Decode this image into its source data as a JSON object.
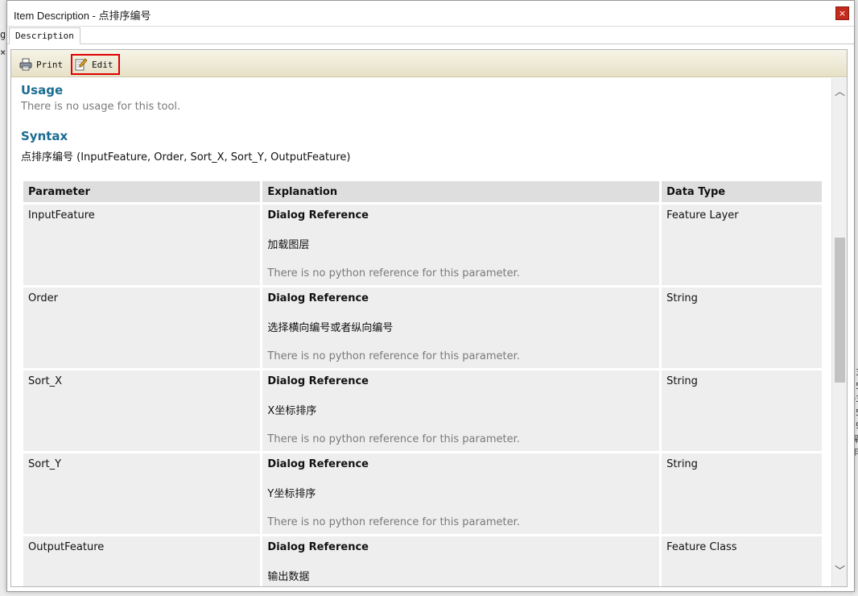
{
  "window": {
    "title": "Item Description - 点排序编号",
    "close_label": "×"
  },
  "tabs": [
    {
      "label": "Description"
    }
  ],
  "toolbar": {
    "print_label": "Print",
    "edit_label": "Edit"
  },
  "usage": {
    "heading": "Usage",
    "text": "There is no usage for this tool."
  },
  "syntax": {
    "heading": "Syntax",
    "line": "点排序编号 (InputFeature, Order, Sort_X, Sort_Y, OutputFeature)"
  },
  "table": {
    "headers": [
      "Parameter",
      "Explanation",
      "Data Type"
    ],
    "rows": [
      {
        "parameter": "InputFeature",
        "dialog_ref": "Dialog Reference",
        "description": "加载图层",
        "python_ref": "There is no python reference for this parameter.",
        "data_type": "Feature Layer"
      },
      {
        "parameter": "Order",
        "dialog_ref": "Dialog Reference",
        "description": "选择横向编号或者纵向编号",
        "python_ref": "There is no python reference for this parameter.",
        "data_type": "String"
      },
      {
        "parameter": "Sort_X",
        "dialog_ref": "Dialog Reference",
        "description": "X坐标排序",
        "python_ref": "There is no python reference for this parameter.",
        "data_type": "String"
      },
      {
        "parameter": "Sort_Y",
        "dialog_ref": "Dialog Reference",
        "description": "Y坐标排序",
        "python_ref": "There is no python reference for this parameter.",
        "data_type": "String"
      },
      {
        "parameter": "OutputFeature",
        "dialog_ref": "Dialog Reference",
        "description": "输出数据",
        "python_ref": "",
        "data_type": "Feature Class"
      }
    ]
  },
  "scrollbar": {
    "up_glyph": "︿",
    "down_glyph": "﹀"
  },
  "background": {
    "left_glyphs": [
      "g",
      "×"
    ],
    "right_glyphs": [
      "53",
      "25",
      "03",
      "35",
      "59",
      "解",
      "",
      "年"
    ]
  },
  "colors": {
    "heading": "#1b6c91",
    "close_button": "#c42b1c",
    "highlight_border": "#e00000",
    "toolbar_bg": "#ece8d2"
  },
  "icons": {
    "print": "printer-icon",
    "edit": "edit-pencil-icon"
  }
}
